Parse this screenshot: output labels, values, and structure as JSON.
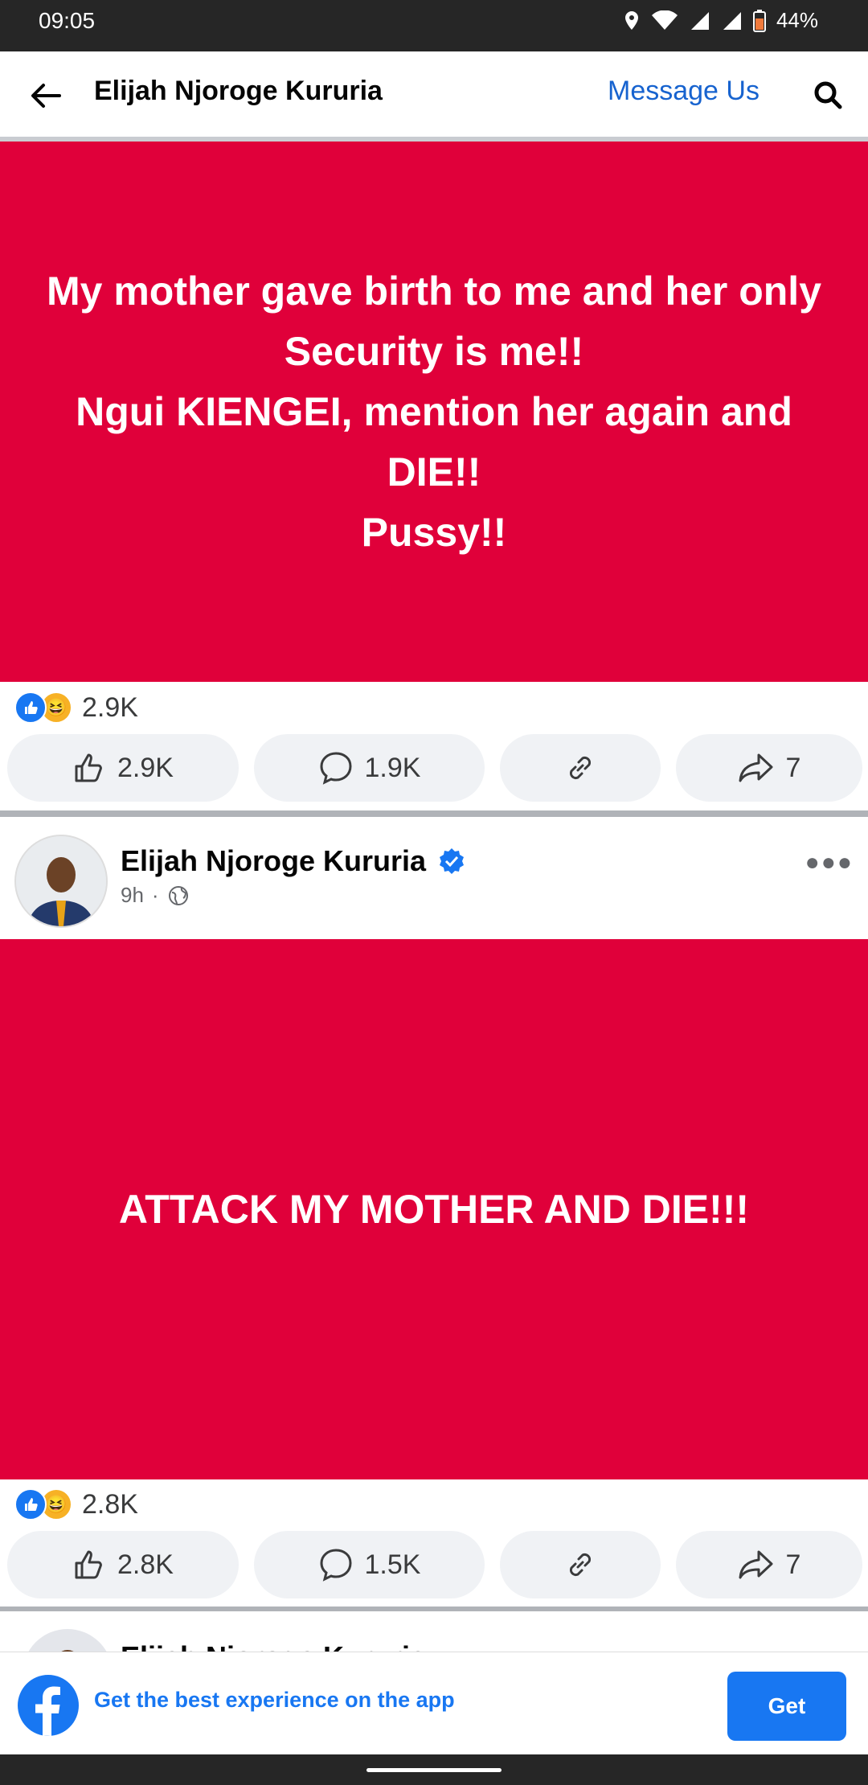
{
  "status": {
    "time": "09:05",
    "battery": "44%"
  },
  "header": {
    "title": "Elijah Njoroge Kururia",
    "message_us": "Message Us"
  },
  "posts": [
    {
      "text": "My mother gave birth to me and her only\nSecurity is me!!\nNgui KIENGEI, mention her again and\nDIE!!\nPussy!!",
      "reaction_count": "2.9K",
      "actions": {
        "likes": "2.9K",
        "comments": "1.9K",
        "shares": "7"
      }
    },
    {
      "author": "Elijah Njoroge Kururia",
      "time": "9h",
      "text": "ATTACK MY MOTHER AND DIE!!!",
      "reaction_count": "2.8K",
      "actions": {
        "likes": "2.8K",
        "comments": "1.5K",
        "shares": "7"
      }
    },
    {
      "author": "Elijah Njoroge Kururia"
    }
  ],
  "banner": {
    "text": "Get the best experience on the app",
    "button": "Get"
  },
  "colors": {
    "card_red": "#e0003a",
    "fb_blue": "#1877f2",
    "link_blue": "#1763cf"
  }
}
